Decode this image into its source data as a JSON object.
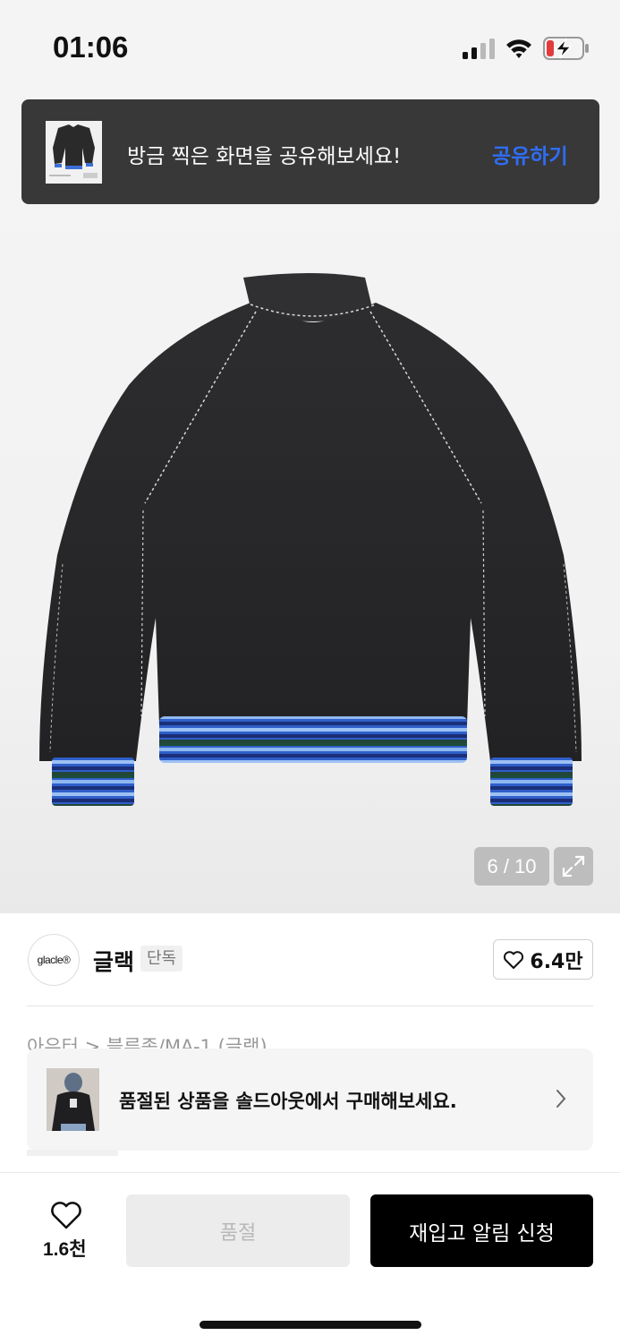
{
  "status_bar": {
    "time": "01:06"
  },
  "share_banner": {
    "message": "방금 찍은 화면을 공유해보세요!",
    "action": "공유하기"
  },
  "gallery": {
    "counter": "6 / 10"
  },
  "brand": {
    "logo_text": "glacle®",
    "name": "글랙",
    "badge": "단독",
    "like_count": "6.4만"
  },
  "breadcrumb": "아우터 > 블루종/MA-1 (글랙)",
  "soldout_banner": {
    "message": "품절된 상품을 솔드아웃에서 구매해보세요."
  },
  "bottom_bar": {
    "wish_count": "1.6천",
    "soldout_label": "품절",
    "restock_label": "재입고 알림 신청"
  },
  "colors": {
    "accent_blue": "#2f6df6",
    "banner_bg": "#383838",
    "primary_button": "#000000"
  }
}
